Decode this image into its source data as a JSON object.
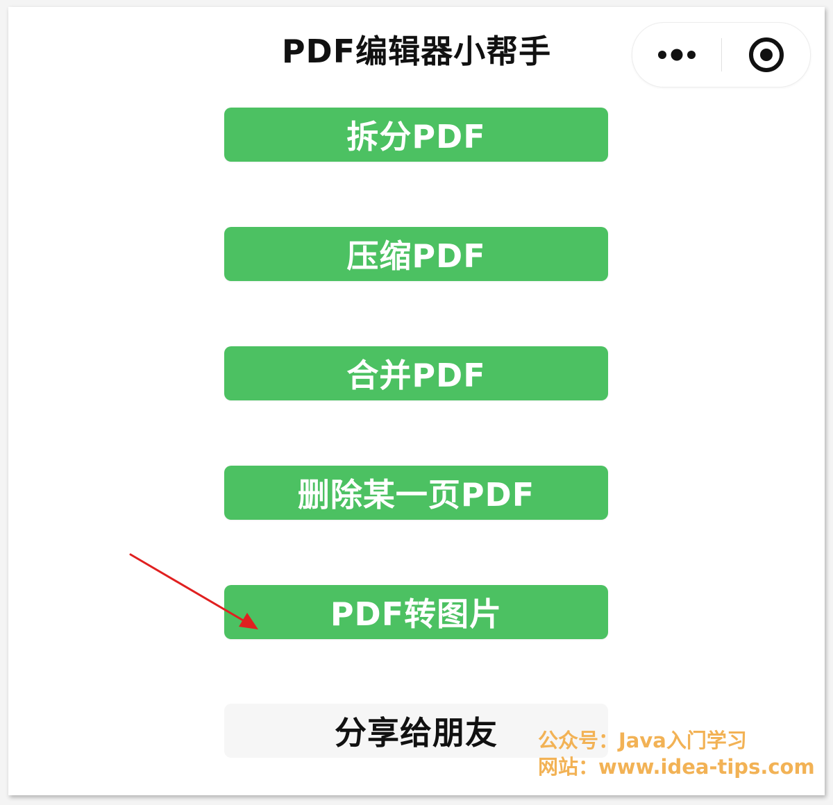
{
  "header": {
    "title": "PDF编辑器小帮手",
    "more_icon": "more-dots-icon",
    "close_icon": "target-close-icon"
  },
  "menu": {
    "items": [
      {
        "label": "拆分PDF"
      },
      {
        "label": "压缩PDF"
      },
      {
        "label": "合并PDF"
      },
      {
        "label": "删除某一页PDF"
      },
      {
        "label": "PDF转图片"
      }
    ]
  },
  "share": {
    "label": "分享给朋友"
  },
  "watermark": {
    "line1": "公众号：Java入门学习",
    "line2": "网站：www.idea-tips.com"
  },
  "colors": {
    "accent": "#4cc162",
    "annotation_arrow": "#e02020",
    "watermark": "#f2b255"
  }
}
